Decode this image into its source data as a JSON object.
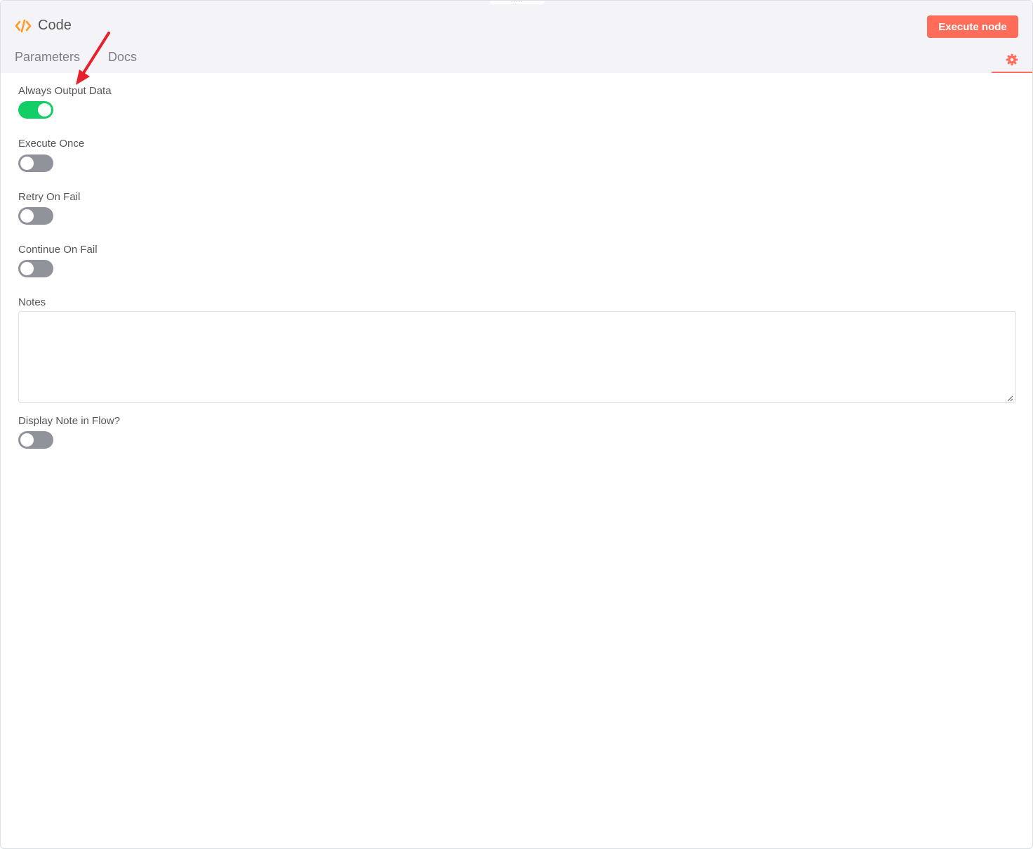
{
  "header": {
    "title": "Code",
    "execute_button_label": "Execute node",
    "tabs": [
      {
        "label": "Parameters"
      },
      {
        "label": "Docs"
      }
    ],
    "drag_handle_glyph": "·····"
  },
  "settings": {
    "fields": [
      {
        "label": "Always Output Data",
        "checked": true
      },
      {
        "label": "Execute Once",
        "checked": false
      },
      {
        "label": "Retry On Fail",
        "checked": false
      },
      {
        "label": "Continue On Fail",
        "checked": false
      }
    ],
    "notes": {
      "label": "Notes",
      "value": "",
      "placeholder": ""
    },
    "display_note": {
      "label": "Display Note in Flow?",
      "checked": false
    }
  },
  "colors": {
    "accent": "#ff6d5a",
    "toggle_on": "#13ce66",
    "toggle_off": "#909399",
    "code_icon": "#ff9b26",
    "annotation": "#e8202a"
  },
  "icons": {
    "title": "code-icon",
    "settings_tab": "gear-icon",
    "annotation": "red-arrow-icon"
  }
}
